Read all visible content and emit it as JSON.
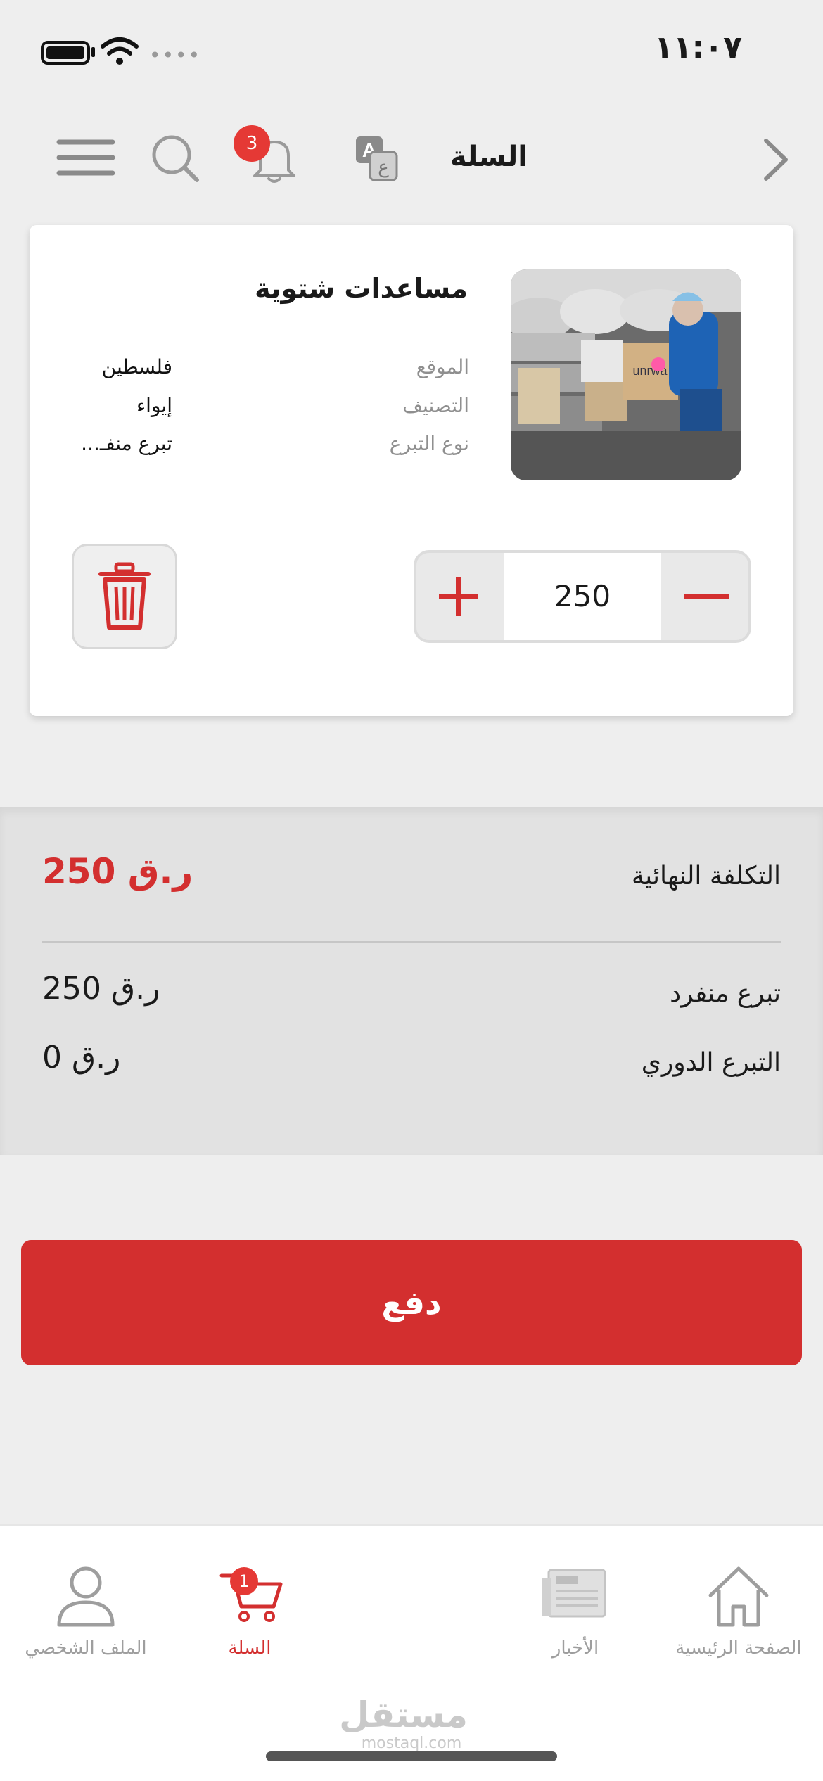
{
  "status_bar": {
    "time": "١١:٠٧",
    "signal_dots": "••••"
  },
  "header": {
    "title": "السلة",
    "notification_count": "3",
    "icons": [
      "chevron-right-icon",
      "translate-icon",
      "bell-icon",
      "search-icon",
      "menu-icon"
    ]
  },
  "cart_item": {
    "title": "مساعدات شتوية",
    "meta": [
      {
        "label": "الموقع",
        "value": "فلسطين"
      },
      {
        "label": "التصنيف",
        "value": "إيواء"
      },
      {
        "label": "نوع التبرع",
        "value": "تبرع منفـ..."
      }
    ],
    "quantity": "250",
    "image_text": "unrwa"
  },
  "summary": {
    "total_label": "التكلفة النهائية",
    "total_value": "ر.ق 250",
    "rows": [
      {
        "label": "تبرع منفرد",
        "value": "ر.ق 250"
      },
      {
        "label": "التبرع الدوري",
        "value": "ر.ق 0"
      }
    ]
  },
  "pay_button": {
    "label": "دفع"
  },
  "bottom_nav": {
    "items": [
      {
        "label": "الصفحة الرئيسية",
        "icon": "home-icon",
        "active": false
      },
      {
        "label": "الأخبار",
        "icon": "news-icon",
        "active": false
      },
      {
        "label": "السلة",
        "icon": "cart-icon",
        "active": true,
        "badge": "1"
      },
      {
        "label": "الملف الشخصي",
        "icon": "profile-icon",
        "active": false
      }
    ]
  },
  "watermark": {
    "arabic": "مستقل",
    "latin": "mostaql.com"
  },
  "colors": {
    "accent": "#d32f2f",
    "background": "#eeeeee",
    "badge": "#e53935"
  }
}
